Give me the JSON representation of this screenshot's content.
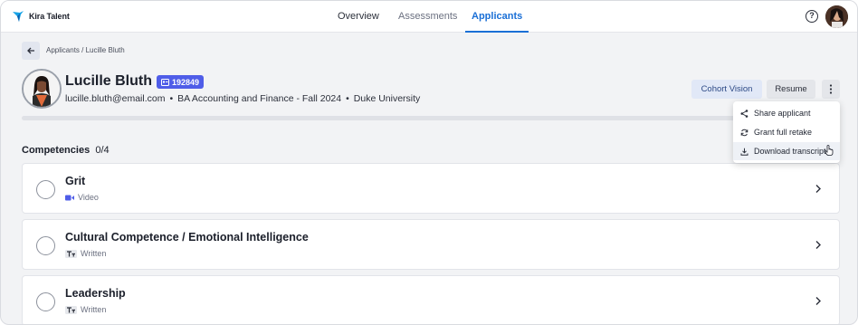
{
  "app": {
    "logo_text": "Kira Talent"
  },
  "nav": {
    "tabs": [
      {
        "label": "Overview"
      },
      {
        "label": "Assessments"
      },
      {
        "label": "Applicants",
        "active": true
      }
    ],
    "help_glyph": "?"
  },
  "breadcrumb": {
    "text": "Applicants / Lucille Bluth"
  },
  "applicant": {
    "name": "Lucille Bluth",
    "id": "192849",
    "email": "lucille.bluth@email.com",
    "program": "BA Accounting and Finance - Fall 2024",
    "school": "Duke University",
    "separator": "•",
    "progress_fraction": 0
  },
  "actions": {
    "cohort_label": "Cohort Vision",
    "resume_label": "Resume",
    "more_icon": "vertical-dots-icon"
  },
  "menu": {
    "items": [
      {
        "label": "Share applicant",
        "icon": "share-icon"
      },
      {
        "label": "Grant full retake",
        "icon": "refresh-icon"
      },
      {
        "label": "Download transcript",
        "icon": "download-icon",
        "hovered": true
      }
    ]
  },
  "competencies": {
    "title": "Competencies",
    "count": "0/4",
    "items": [
      {
        "title": "Grit",
        "type": "Video",
        "type_icon": "video-icon"
      },
      {
        "title": "Cultural Competence / Emotional Intelligence",
        "type": "Written",
        "type_icon": "text-icon"
      },
      {
        "title": "Leadership",
        "type": "Written",
        "type_icon": "text-icon"
      }
    ]
  },
  "colors": {
    "accent": "#1a6fd6",
    "badge": "#4f5de8",
    "cohort_bg": "#e1e8f7"
  }
}
